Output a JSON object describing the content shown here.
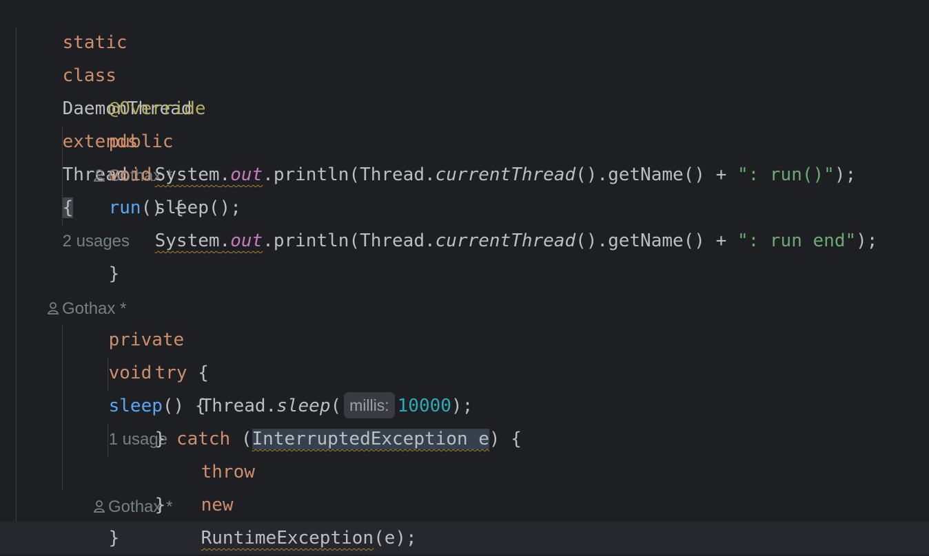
{
  "code": {
    "line1": {
      "static": "static",
      "class": "class",
      "class_name": "DaemonThread",
      "extends": "extends",
      "parent": "Thread",
      "brace": "{",
      "usages": "2 usages",
      "author": "Gothax *"
    },
    "line3": {
      "annotation": "@Override",
      "author": "Gothax *"
    },
    "line4": {
      "public": "public",
      "void": "void",
      "method": "run",
      "rest": "() {"
    },
    "line5": {
      "system": "System",
      "dot1": ".",
      "out": "out",
      "call": ".println(Thread.",
      "current": "currentThread",
      "rest": "().getName() + ",
      "string": "\": run()\"",
      "end": ");"
    },
    "line6": {
      "text": "sleep();"
    },
    "line7": {
      "system": "System",
      "dot1": ".",
      "out": "out",
      "call": ".println(Thread.",
      "current": "currentThread",
      "rest": "().getName() + ",
      "string": "\": run end\"",
      "end": ");"
    },
    "line8": {
      "text": "}"
    },
    "line10": {
      "private": "private",
      "void": "void",
      "method": "sleep",
      "rest": "() {",
      "usages": "1 usage",
      "author": "Gothax *"
    },
    "line11": {
      "try": "try",
      "rest": " {"
    },
    "line12": {
      "thread": "Thread.",
      "sleep": "sleep",
      "open": "(",
      "param_hint": "millis:",
      "value": "10000",
      "end": ");"
    },
    "line13": {
      "open": "} ",
      "catch": "catch",
      "paren": " (",
      "param": "InterruptedException e",
      "end": ") {"
    },
    "line14": {
      "throw": "throw",
      "new": "new",
      "exception": "RuntimeException",
      "end": "(e);"
    },
    "line15": {
      "text": "}"
    },
    "line16": {
      "text": "}"
    },
    "line17": {
      "text": "}"
    }
  }
}
